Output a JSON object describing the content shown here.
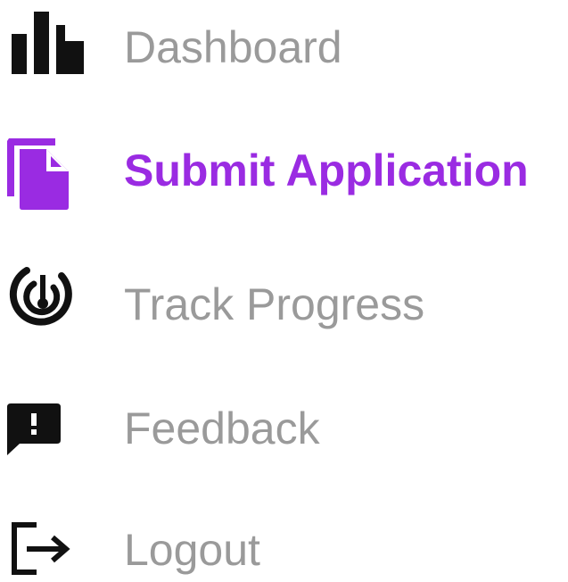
{
  "colors": {
    "inactive_text": "#9a9a9a",
    "active_text": "#9a2be2",
    "active_icon": "#9a2be2",
    "inactive_icon": "#111111"
  },
  "nav": {
    "items": [
      {
        "label": "Dashboard",
        "icon": "bar-chart-icon",
        "active": false
      },
      {
        "label": "Submit Application",
        "icon": "document-copy-icon",
        "active": true
      },
      {
        "label": "Track Progress",
        "icon": "radar-target-icon",
        "active": false
      },
      {
        "label": "Feedback",
        "icon": "feedback-alert-icon",
        "active": false
      },
      {
        "label": "Logout",
        "icon": "logout-icon",
        "active": false
      }
    ]
  }
}
